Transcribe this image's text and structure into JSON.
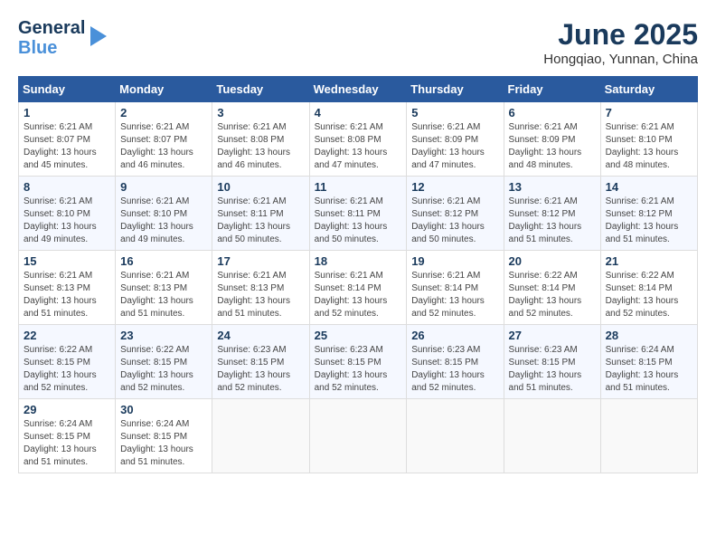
{
  "header": {
    "logo_general": "General",
    "logo_blue": "Blue",
    "month_title": "June 2025",
    "location": "Hongqiao, Yunnan, China"
  },
  "calendar": {
    "days_of_week": [
      "Sunday",
      "Monday",
      "Tuesday",
      "Wednesday",
      "Thursday",
      "Friday",
      "Saturday"
    ],
    "weeks": [
      [
        null,
        null,
        null,
        null,
        null,
        null,
        null
      ]
    ]
  },
  "cells": {
    "row1": [
      {
        "num": "1",
        "sunrise": "6:21 AM",
        "sunset": "8:07 PM",
        "daylight": "13 hours and 45 minutes."
      },
      {
        "num": "2",
        "sunrise": "6:21 AM",
        "sunset": "8:07 PM",
        "daylight": "13 hours and 46 minutes."
      },
      {
        "num": "3",
        "sunrise": "6:21 AM",
        "sunset": "8:08 PM",
        "daylight": "13 hours and 46 minutes."
      },
      {
        "num": "4",
        "sunrise": "6:21 AM",
        "sunset": "8:08 PM",
        "daylight": "13 hours and 47 minutes."
      },
      {
        "num": "5",
        "sunrise": "6:21 AM",
        "sunset": "8:09 PM",
        "daylight": "13 hours and 47 minutes."
      },
      {
        "num": "6",
        "sunrise": "6:21 AM",
        "sunset": "8:09 PM",
        "daylight": "13 hours and 48 minutes."
      },
      {
        "num": "7",
        "sunrise": "6:21 AM",
        "sunset": "8:10 PM",
        "daylight": "13 hours and 48 minutes."
      }
    ],
    "row2": [
      {
        "num": "8",
        "sunrise": "6:21 AM",
        "sunset": "8:10 PM",
        "daylight": "13 hours and 49 minutes."
      },
      {
        "num": "9",
        "sunrise": "6:21 AM",
        "sunset": "8:10 PM",
        "daylight": "13 hours and 49 minutes."
      },
      {
        "num": "10",
        "sunrise": "6:21 AM",
        "sunset": "8:11 PM",
        "daylight": "13 hours and 50 minutes."
      },
      {
        "num": "11",
        "sunrise": "6:21 AM",
        "sunset": "8:11 PM",
        "daylight": "13 hours and 50 minutes."
      },
      {
        "num": "12",
        "sunrise": "6:21 AM",
        "sunset": "8:12 PM",
        "daylight": "13 hours and 50 minutes."
      },
      {
        "num": "13",
        "sunrise": "6:21 AM",
        "sunset": "8:12 PM",
        "daylight": "13 hours and 51 minutes."
      },
      {
        "num": "14",
        "sunrise": "6:21 AM",
        "sunset": "8:12 PM",
        "daylight": "13 hours and 51 minutes."
      }
    ],
    "row3": [
      {
        "num": "15",
        "sunrise": "6:21 AM",
        "sunset": "8:13 PM",
        "daylight": "13 hours and 51 minutes."
      },
      {
        "num": "16",
        "sunrise": "6:21 AM",
        "sunset": "8:13 PM",
        "daylight": "13 hours and 51 minutes."
      },
      {
        "num": "17",
        "sunrise": "6:21 AM",
        "sunset": "8:13 PM",
        "daylight": "13 hours and 51 minutes."
      },
      {
        "num": "18",
        "sunrise": "6:21 AM",
        "sunset": "8:14 PM",
        "daylight": "13 hours and 52 minutes."
      },
      {
        "num": "19",
        "sunrise": "6:21 AM",
        "sunset": "8:14 PM",
        "daylight": "13 hours and 52 minutes."
      },
      {
        "num": "20",
        "sunrise": "6:22 AM",
        "sunset": "8:14 PM",
        "daylight": "13 hours and 52 minutes."
      },
      {
        "num": "21",
        "sunrise": "6:22 AM",
        "sunset": "8:14 PM",
        "daylight": "13 hours and 52 minutes."
      }
    ],
    "row4": [
      {
        "num": "22",
        "sunrise": "6:22 AM",
        "sunset": "8:15 PM",
        "daylight": "13 hours and 52 minutes."
      },
      {
        "num": "23",
        "sunrise": "6:22 AM",
        "sunset": "8:15 PM",
        "daylight": "13 hours and 52 minutes."
      },
      {
        "num": "24",
        "sunrise": "6:23 AM",
        "sunset": "8:15 PM",
        "daylight": "13 hours and 52 minutes."
      },
      {
        "num": "25",
        "sunrise": "6:23 AM",
        "sunset": "8:15 PM",
        "daylight": "13 hours and 52 minutes."
      },
      {
        "num": "26",
        "sunrise": "6:23 AM",
        "sunset": "8:15 PM",
        "daylight": "13 hours and 52 minutes."
      },
      {
        "num": "27",
        "sunrise": "6:23 AM",
        "sunset": "8:15 PM",
        "daylight": "13 hours and 51 minutes."
      },
      {
        "num": "28",
        "sunrise": "6:24 AM",
        "sunset": "8:15 PM",
        "daylight": "13 hours and 51 minutes."
      }
    ],
    "row5": [
      {
        "num": "29",
        "sunrise": "6:24 AM",
        "sunset": "8:15 PM",
        "daylight": "13 hours and 51 minutes."
      },
      {
        "num": "30",
        "sunrise": "6:24 AM",
        "sunset": "8:15 PM",
        "daylight": "13 hours and 51 minutes."
      },
      null,
      null,
      null,
      null,
      null
    ]
  },
  "labels": {
    "sunrise": "Sunrise:",
    "sunset": "Sunset:",
    "daylight": "Daylight:"
  }
}
